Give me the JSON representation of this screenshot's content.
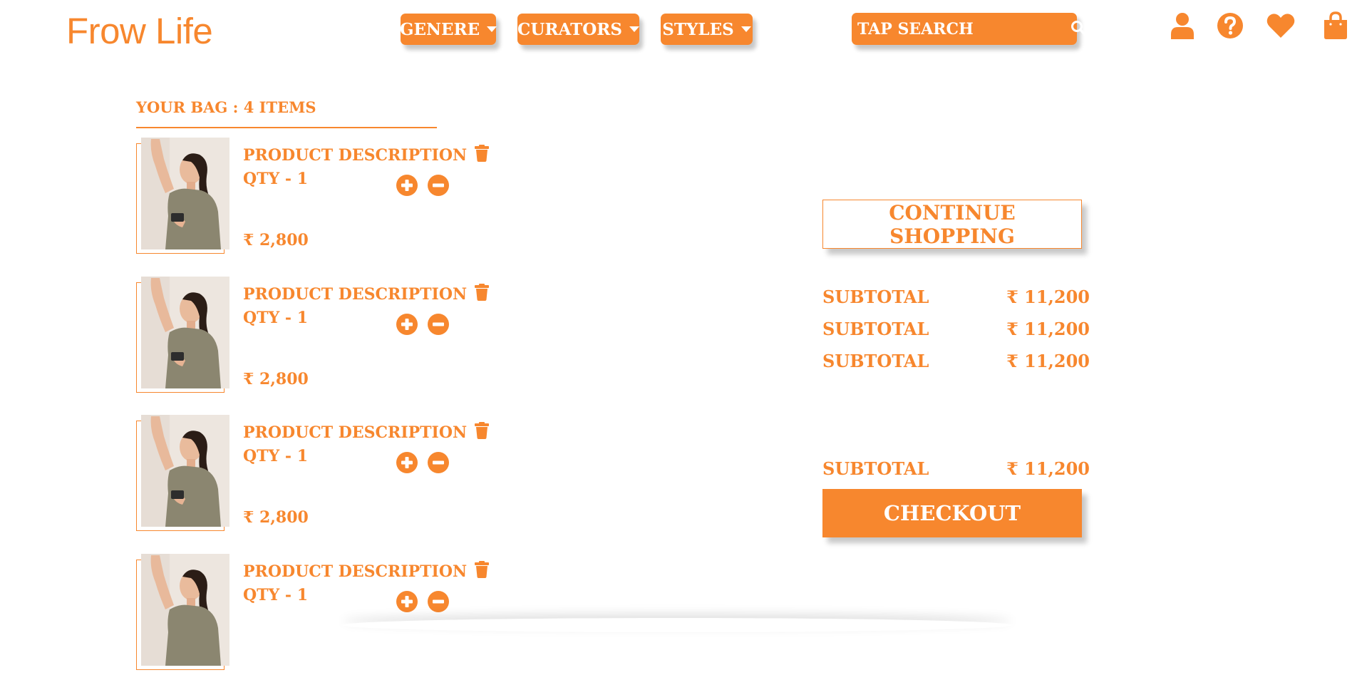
{
  "header": {
    "logo": "Frow Life",
    "nav": [
      {
        "label": "GENERE"
      },
      {
        "label": "CURATORS"
      },
      {
        "label": "STYLES"
      }
    ],
    "search_placeholder": "TAP SEARCH",
    "icons": [
      "user-icon",
      "help-icon",
      "heart-icon",
      "shopping-bag-icon"
    ]
  },
  "bag": {
    "title": "YOUR BAG : 4 ITEMS",
    "items": [
      {
        "description": "PRODUCT DESCRIPTION",
        "qty": "QTY - 1",
        "price": "₹ 2,800"
      },
      {
        "description": "PRODUCT DESCRIPTION",
        "qty": "QTY - 1",
        "price": "₹ 2,800"
      },
      {
        "description": "PRODUCT DESCRIPTION",
        "qty": "QTY - 1",
        "price": "₹ 2,800"
      },
      {
        "description": "PRODUCT DESCRIPTION",
        "qty": "QTY - 1",
        "price": ""
      }
    ]
  },
  "summary": {
    "continue_label": "CONTINUE SHOPPING",
    "rows": [
      {
        "label": "SUBTOTAL",
        "value": "₹ 11,200"
      },
      {
        "label": "SUBTOTAL",
        "value": "₹ 11,200"
      },
      {
        "label": "SUBTOTAL",
        "value": "₹ 11,200"
      }
    ],
    "total": {
      "label": "SUBTOTAL",
      "value": "₹ 11,200"
    },
    "checkout_label": "CHECKOUT"
  },
  "colors": {
    "accent": "#f7872e",
    "background": "#ffffff"
  }
}
